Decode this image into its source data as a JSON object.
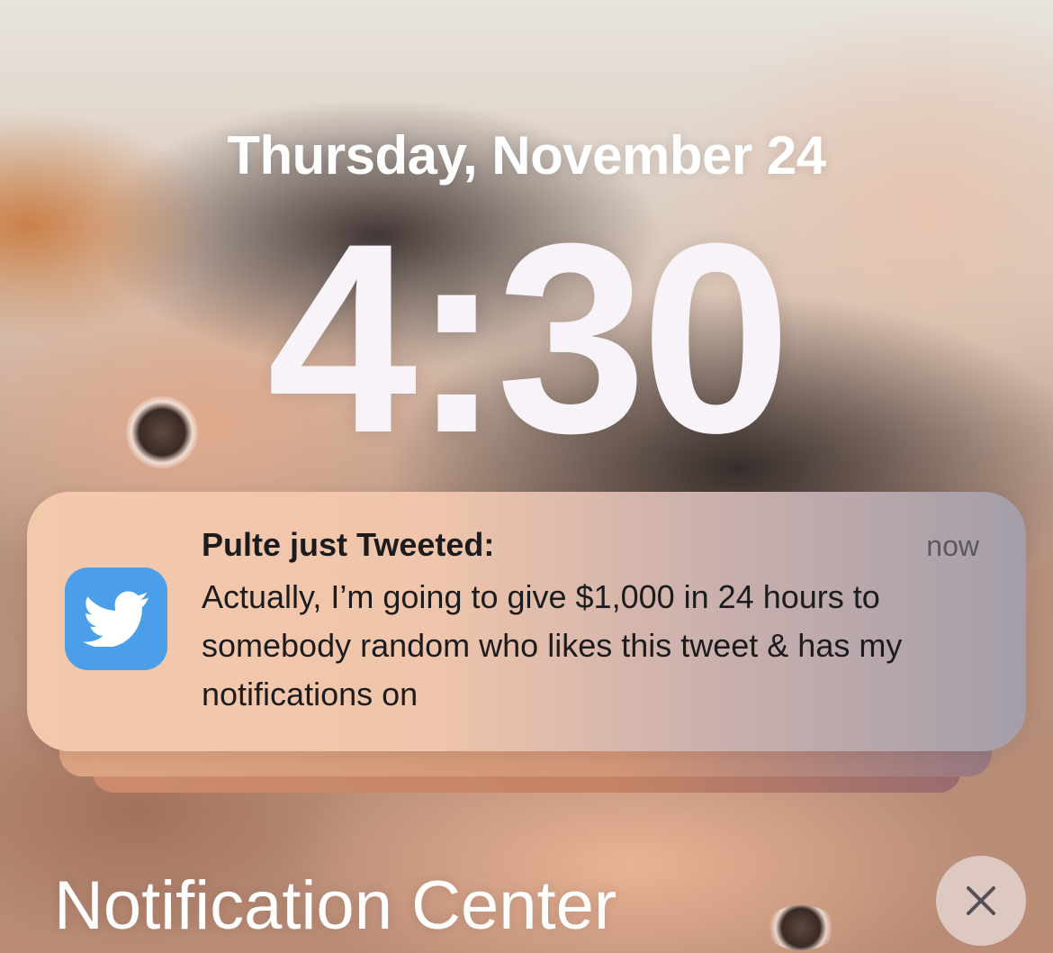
{
  "lock_screen": {
    "date": "Thursday, November 24",
    "time": "4:30"
  },
  "notification": {
    "app_icon": "twitter-bird-icon",
    "title": "Pulte just Tweeted:",
    "timestamp": "now",
    "body": "Actually, I’m going to give $1,000 in 24 hours to somebody random who likes this tweet & has my notifications on"
  },
  "footer": {
    "label": "Notification Center",
    "close_icon": "close-icon"
  },
  "colors": {
    "twitter_blue": "#4a9fe8"
  }
}
